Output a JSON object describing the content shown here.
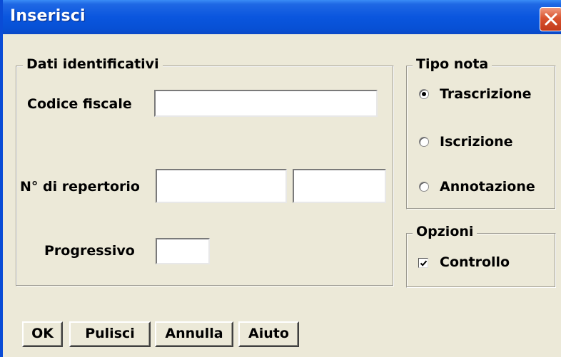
{
  "window": {
    "title": "Inserisci",
    "close_icon": "close-icon"
  },
  "dati_group": {
    "legend": "Dati identificativi",
    "codice_fiscale_label": "Codice fiscale",
    "codice_fiscale_value": "",
    "repertorio_label": "N° di repertorio",
    "repertorio_value_1": "",
    "repertorio_value_2": "",
    "progressivo_label": "Progressivo",
    "progressivo_value": ""
  },
  "tipo_nota": {
    "legend": "Tipo nota",
    "options": [
      {
        "label": "Trascrizione",
        "selected": true
      },
      {
        "label": "Iscrizione",
        "selected": false
      },
      {
        "label": "Annotazione",
        "selected": false
      }
    ]
  },
  "opzioni": {
    "legend": "Opzioni",
    "controllo_label": "Controllo",
    "controllo_checked": true
  },
  "buttons": {
    "ok": "OK",
    "pulisci": "Pulisci",
    "annulla": "Annulla",
    "aiuto": "Aiuto"
  }
}
